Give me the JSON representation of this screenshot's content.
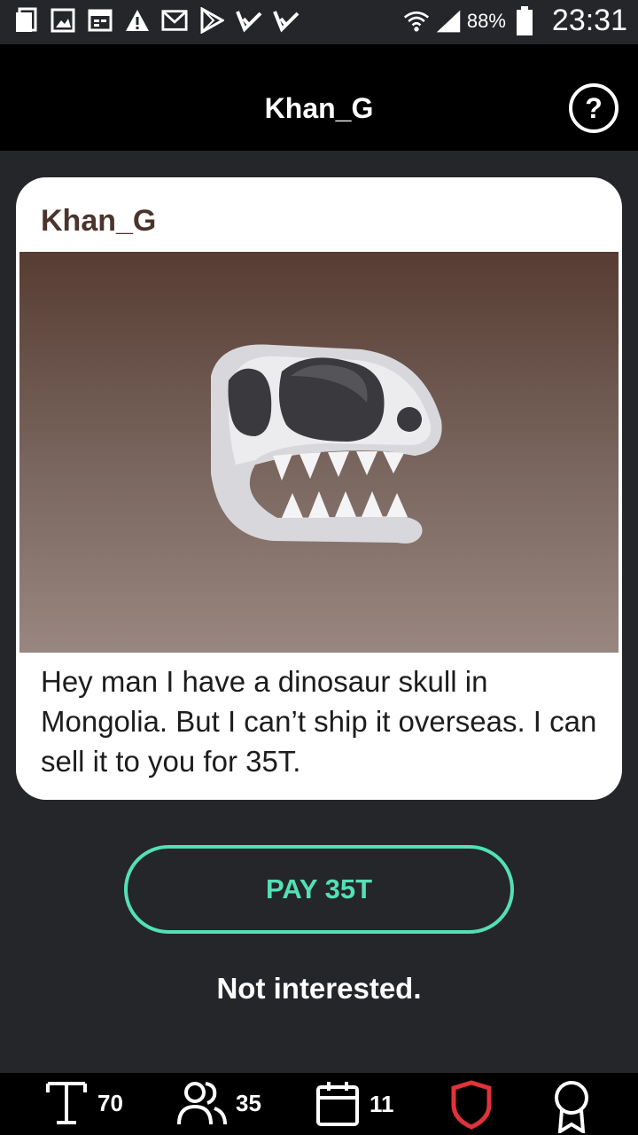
{
  "status_bar": {
    "battery": "88%",
    "time": "23:31",
    "icons": [
      "copy-icon",
      "image-icon",
      "calendar-icon",
      "warning-icon",
      "gmail-icon",
      "play-store-icon",
      "check-icon",
      "check-icon",
      "wifi-icon",
      "signal-icon",
      "battery-icon"
    ]
  },
  "app_bar": {
    "title": "Khan_G",
    "help_label": "?"
  },
  "message_card": {
    "sender": "Khan_G",
    "image_icon": "dinosaur-skull",
    "text": "Hey man I have a dinosaur skull in Mongolia. But I can’t ship it overseas. I can sell it to you for 35T."
  },
  "actions": {
    "pay_label": "PAY 35T",
    "decline_label": "Not interested."
  },
  "bottom_bar": {
    "tokens": "70",
    "followers": "35",
    "days": "11"
  },
  "colors": {
    "accent": "#53e0b4",
    "shield": "#e0323a",
    "background": "#25262a"
  }
}
